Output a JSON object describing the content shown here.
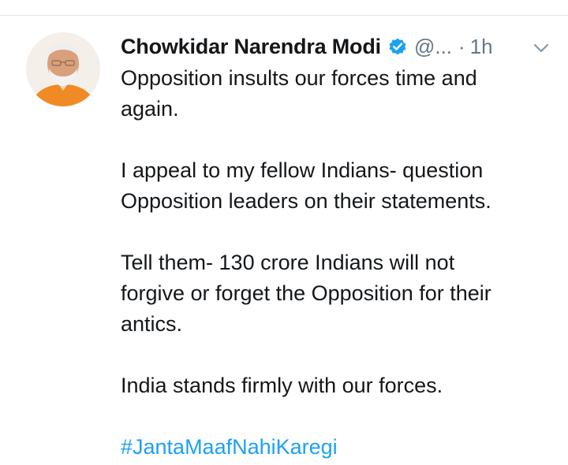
{
  "tweet": {
    "author_name": "Chowkidar Narendra Modi",
    "verified_icon": "verified-badge-icon",
    "handle": "@...",
    "separator": "·",
    "timestamp": "1h",
    "menu_icon": "chevron-down-icon",
    "paragraphs": [
      "Opposition insults our forces time and\nagain.",
      "I appeal to my fellow Indians- question\nOpposition leaders on their statements.",
      "Tell them- 130 crore Indians will not\nforgive or forget the Opposition for their\nantics.",
      "India stands firmly with our forces."
    ],
    "hashtag": "#JantaMaafNahiKaregi"
  },
  "colors": {
    "text": "#14171a",
    "muted": "#657786",
    "accent": "#1da1f2",
    "divider": "#e1e8ed"
  }
}
